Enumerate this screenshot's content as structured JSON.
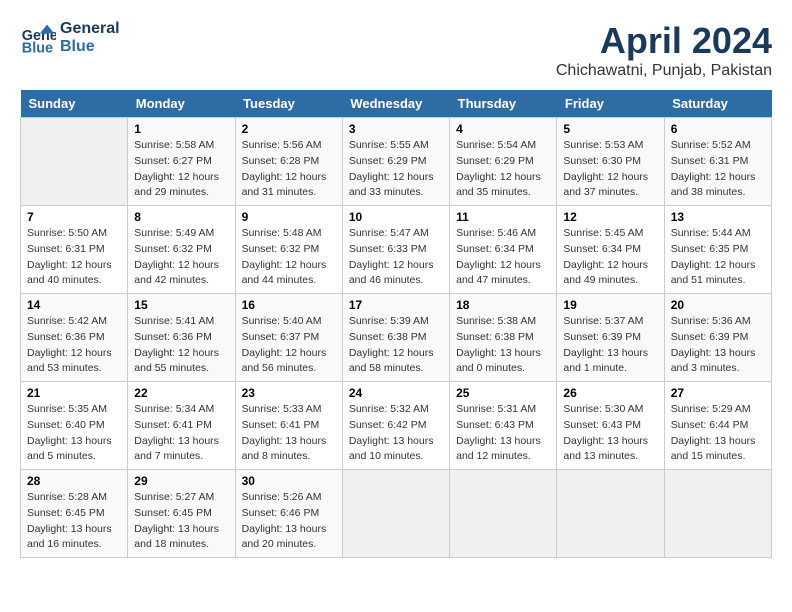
{
  "logo": {
    "line1": "General",
    "line2": "Blue"
  },
  "title": "April 2024",
  "location": "Chichawatni, Punjab, Pakistan",
  "headers": [
    "Sunday",
    "Monday",
    "Tuesday",
    "Wednesday",
    "Thursday",
    "Friday",
    "Saturday"
  ],
  "weeks": [
    [
      {
        "day": "",
        "detail": ""
      },
      {
        "day": "1",
        "detail": "Sunrise: 5:58 AM\nSunset: 6:27 PM\nDaylight: 12 hours\nand 29 minutes."
      },
      {
        "day": "2",
        "detail": "Sunrise: 5:56 AM\nSunset: 6:28 PM\nDaylight: 12 hours\nand 31 minutes."
      },
      {
        "day": "3",
        "detail": "Sunrise: 5:55 AM\nSunset: 6:29 PM\nDaylight: 12 hours\nand 33 minutes."
      },
      {
        "day": "4",
        "detail": "Sunrise: 5:54 AM\nSunset: 6:29 PM\nDaylight: 12 hours\nand 35 minutes."
      },
      {
        "day": "5",
        "detail": "Sunrise: 5:53 AM\nSunset: 6:30 PM\nDaylight: 12 hours\nand 37 minutes."
      },
      {
        "day": "6",
        "detail": "Sunrise: 5:52 AM\nSunset: 6:31 PM\nDaylight: 12 hours\nand 38 minutes."
      }
    ],
    [
      {
        "day": "7",
        "detail": "Sunrise: 5:50 AM\nSunset: 6:31 PM\nDaylight: 12 hours\nand 40 minutes."
      },
      {
        "day": "8",
        "detail": "Sunrise: 5:49 AM\nSunset: 6:32 PM\nDaylight: 12 hours\nand 42 minutes."
      },
      {
        "day": "9",
        "detail": "Sunrise: 5:48 AM\nSunset: 6:32 PM\nDaylight: 12 hours\nand 44 minutes."
      },
      {
        "day": "10",
        "detail": "Sunrise: 5:47 AM\nSunset: 6:33 PM\nDaylight: 12 hours\nand 46 minutes."
      },
      {
        "day": "11",
        "detail": "Sunrise: 5:46 AM\nSunset: 6:34 PM\nDaylight: 12 hours\nand 47 minutes."
      },
      {
        "day": "12",
        "detail": "Sunrise: 5:45 AM\nSunset: 6:34 PM\nDaylight: 12 hours\nand 49 minutes."
      },
      {
        "day": "13",
        "detail": "Sunrise: 5:44 AM\nSunset: 6:35 PM\nDaylight: 12 hours\nand 51 minutes."
      }
    ],
    [
      {
        "day": "14",
        "detail": "Sunrise: 5:42 AM\nSunset: 6:36 PM\nDaylight: 12 hours\nand 53 minutes."
      },
      {
        "day": "15",
        "detail": "Sunrise: 5:41 AM\nSunset: 6:36 PM\nDaylight: 12 hours\nand 55 minutes."
      },
      {
        "day": "16",
        "detail": "Sunrise: 5:40 AM\nSunset: 6:37 PM\nDaylight: 12 hours\nand 56 minutes."
      },
      {
        "day": "17",
        "detail": "Sunrise: 5:39 AM\nSunset: 6:38 PM\nDaylight: 12 hours\nand 58 minutes."
      },
      {
        "day": "18",
        "detail": "Sunrise: 5:38 AM\nSunset: 6:38 PM\nDaylight: 13 hours\nand 0 minutes."
      },
      {
        "day": "19",
        "detail": "Sunrise: 5:37 AM\nSunset: 6:39 PM\nDaylight: 13 hours\nand 1 minute."
      },
      {
        "day": "20",
        "detail": "Sunrise: 5:36 AM\nSunset: 6:39 PM\nDaylight: 13 hours\nand 3 minutes."
      }
    ],
    [
      {
        "day": "21",
        "detail": "Sunrise: 5:35 AM\nSunset: 6:40 PM\nDaylight: 13 hours\nand 5 minutes."
      },
      {
        "day": "22",
        "detail": "Sunrise: 5:34 AM\nSunset: 6:41 PM\nDaylight: 13 hours\nand 7 minutes."
      },
      {
        "day": "23",
        "detail": "Sunrise: 5:33 AM\nSunset: 6:41 PM\nDaylight: 13 hours\nand 8 minutes."
      },
      {
        "day": "24",
        "detail": "Sunrise: 5:32 AM\nSunset: 6:42 PM\nDaylight: 13 hours\nand 10 minutes."
      },
      {
        "day": "25",
        "detail": "Sunrise: 5:31 AM\nSunset: 6:43 PM\nDaylight: 13 hours\nand 12 minutes."
      },
      {
        "day": "26",
        "detail": "Sunrise: 5:30 AM\nSunset: 6:43 PM\nDaylight: 13 hours\nand 13 minutes."
      },
      {
        "day": "27",
        "detail": "Sunrise: 5:29 AM\nSunset: 6:44 PM\nDaylight: 13 hours\nand 15 minutes."
      }
    ],
    [
      {
        "day": "28",
        "detail": "Sunrise: 5:28 AM\nSunset: 6:45 PM\nDaylight: 13 hours\nand 16 minutes."
      },
      {
        "day": "29",
        "detail": "Sunrise: 5:27 AM\nSunset: 6:45 PM\nDaylight: 13 hours\nand 18 minutes."
      },
      {
        "day": "30",
        "detail": "Sunrise: 5:26 AM\nSunset: 6:46 PM\nDaylight: 13 hours\nand 20 minutes."
      },
      {
        "day": "",
        "detail": ""
      },
      {
        "day": "",
        "detail": ""
      },
      {
        "day": "",
        "detail": ""
      },
      {
        "day": "",
        "detail": ""
      }
    ]
  ]
}
